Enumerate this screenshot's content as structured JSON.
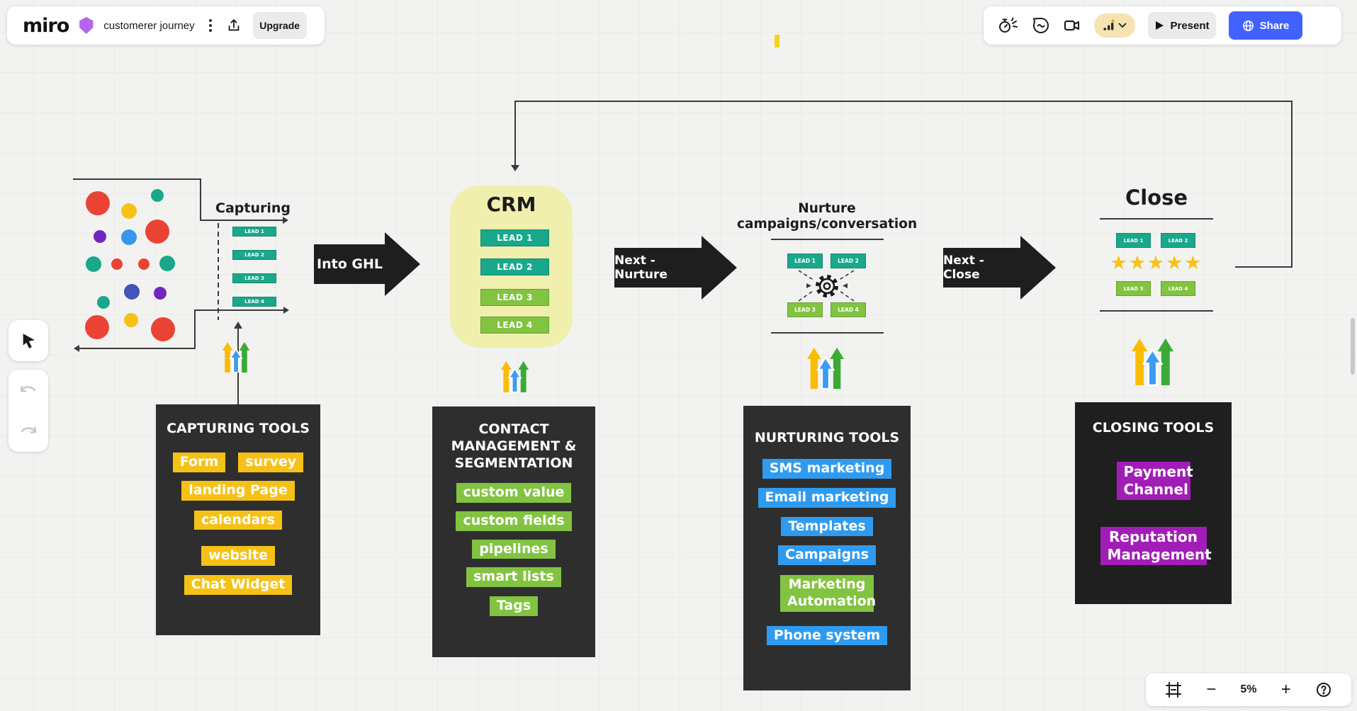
{
  "header": {
    "logo": "miro",
    "board_title": "customerer journey",
    "upgrade_label": "Upgrade",
    "present_label": "Present",
    "share_label": "Share"
  },
  "canvas": {
    "lead_labels": [
      "LEAD 1",
      "LEAD 2",
      "LEAD 3",
      "LEAD 4"
    ],
    "capturing": {
      "title": "Capturing"
    },
    "into_ghl_arrow": "Into GHL",
    "crm": {
      "title": "CRM"
    },
    "next_nurture_arrow": "Next - Nurture",
    "nurture": {
      "title": "Nurture campaigns/conversation"
    },
    "next_close_arrow": "Next - Close",
    "close": {
      "title": "Close",
      "stars": "★★★★★"
    },
    "capturing_tools": {
      "title": "CAPTURING TOOLS",
      "tags": [
        "Form",
        "survey",
        "landing Page",
        "calendars",
        "website",
        "Chat Widget"
      ]
    },
    "contact_management": {
      "title": "CONTACT MANAGEMENT & SEGMENTATION",
      "tags": [
        "custom value",
        "custom fields",
        "pipelines",
        "smart lists",
        "Tags"
      ]
    },
    "nurturing_tools": {
      "title": "NURTURING TOOLS",
      "tags": [
        "SMS marketing",
        "Email marketing",
        "Templates",
        "Campaigns",
        "Marketing Automation",
        "Phone system"
      ]
    },
    "closing_tools": {
      "title": "CLOSING TOOLS",
      "tags": [
        "Payment Channel",
        "Reputation Management"
      ]
    }
  },
  "controls": {
    "zoom_level": "5%"
  },
  "colors": {
    "teal_lead": "#19a88c",
    "green_lead": "#82c341",
    "yellow_tag": "#f6c117",
    "blue_tag": "#2f9bf0",
    "purple_tag": "#a21cb8",
    "share_blue": "#4262ff",
    "crm_bg": "#f0efae",
    "dark_box": "#2e2e2e",
    "star_yellow": "#f6c216",
    "ghl_arrow_yellow": "#fbbc05",
    "ghl_arrow_blue": "#3d9bf3",
    "ghl_arrow_green": "#3baa34"
  }
}
